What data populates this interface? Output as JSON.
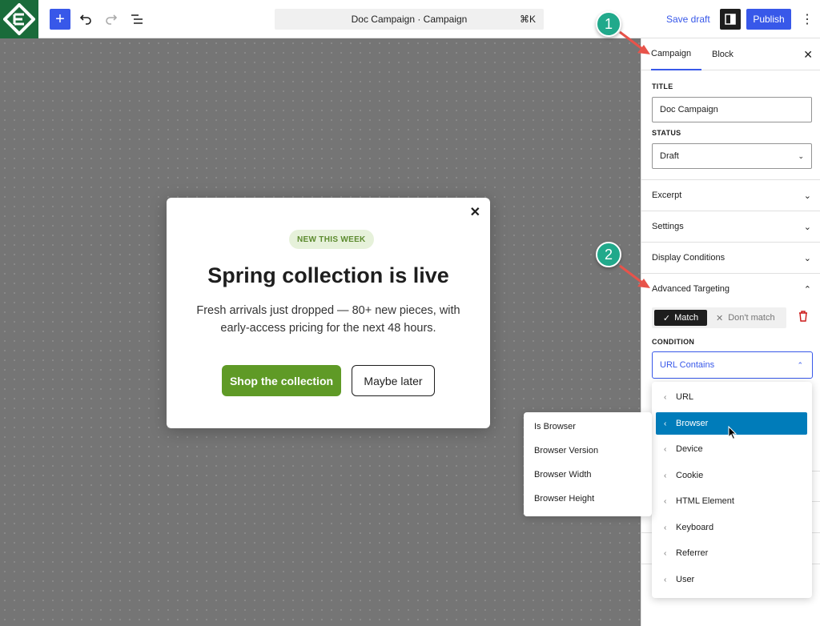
{
  "toolbar": {
    "add_icon": "plus-icon",
    "undo_icon": "undo-icon",
    "redo_icon": "redo-icon",
    "list_view_icon": "list-view-icon",
    "doc_title": "Doc Campaign · Campaign",
    "shortcut": "⌘K",
    "save_draft": "Save draft",
    "publish": "Publish"
  },
  "popup": {
    "badge": "NEW THIS WEEK",
    "title": "Spring collection is live",
    "body": "Fresh arrivals just dropped — 80+ new pieces, with early-access pricing for the next 48 hours.",
    "primary_button": "Shop the collection",
    "secondary_button": "Maybe later"
  },
  "sidebar": {
    "tabs": [
      "Campaign",
      "Block"
    ],
    "active_tab": "Campaign",
    "title_label": "TITLE",
    "title_value": "Doc Campaign",
    "status_label": "STATUS",
    "status_value": "Draft",
    "sections": [
      "Excerpt",
      "Settings",
      "Display Conditions",
      "Advanced Targeting"
    ],
    "match_on": "Match",
    "match_off": "Don't match",
    "condition_label": "CONDITION",
    "condition_value": "URL Contains"
  },
  "dropdown": {
    "items": [
      "URL",
      "Browser",
      "Device",
      "Cookie",
      "HTML Element",
      "Keyboard",
      "Referrer",
      "User"
    ],
    "active": "Browser"
  },
  "submenu": {
    "items": [
      "Is Browser",
      "Browser Version",
      "Browser Width",
      "Browser Height"
    ]
  },
  "annotations": {
    "step1": "1",
    "step2": "2"
  },
  "colors": {
    "accent": "#3858e9",
    "brand_green": "#1a6b3a",
    "cta_green": "#5f9a26",
    "highlight": "#007cba",
    "annotation": "#21a98b",
    "arrow": "#e8534a"
  }
}
